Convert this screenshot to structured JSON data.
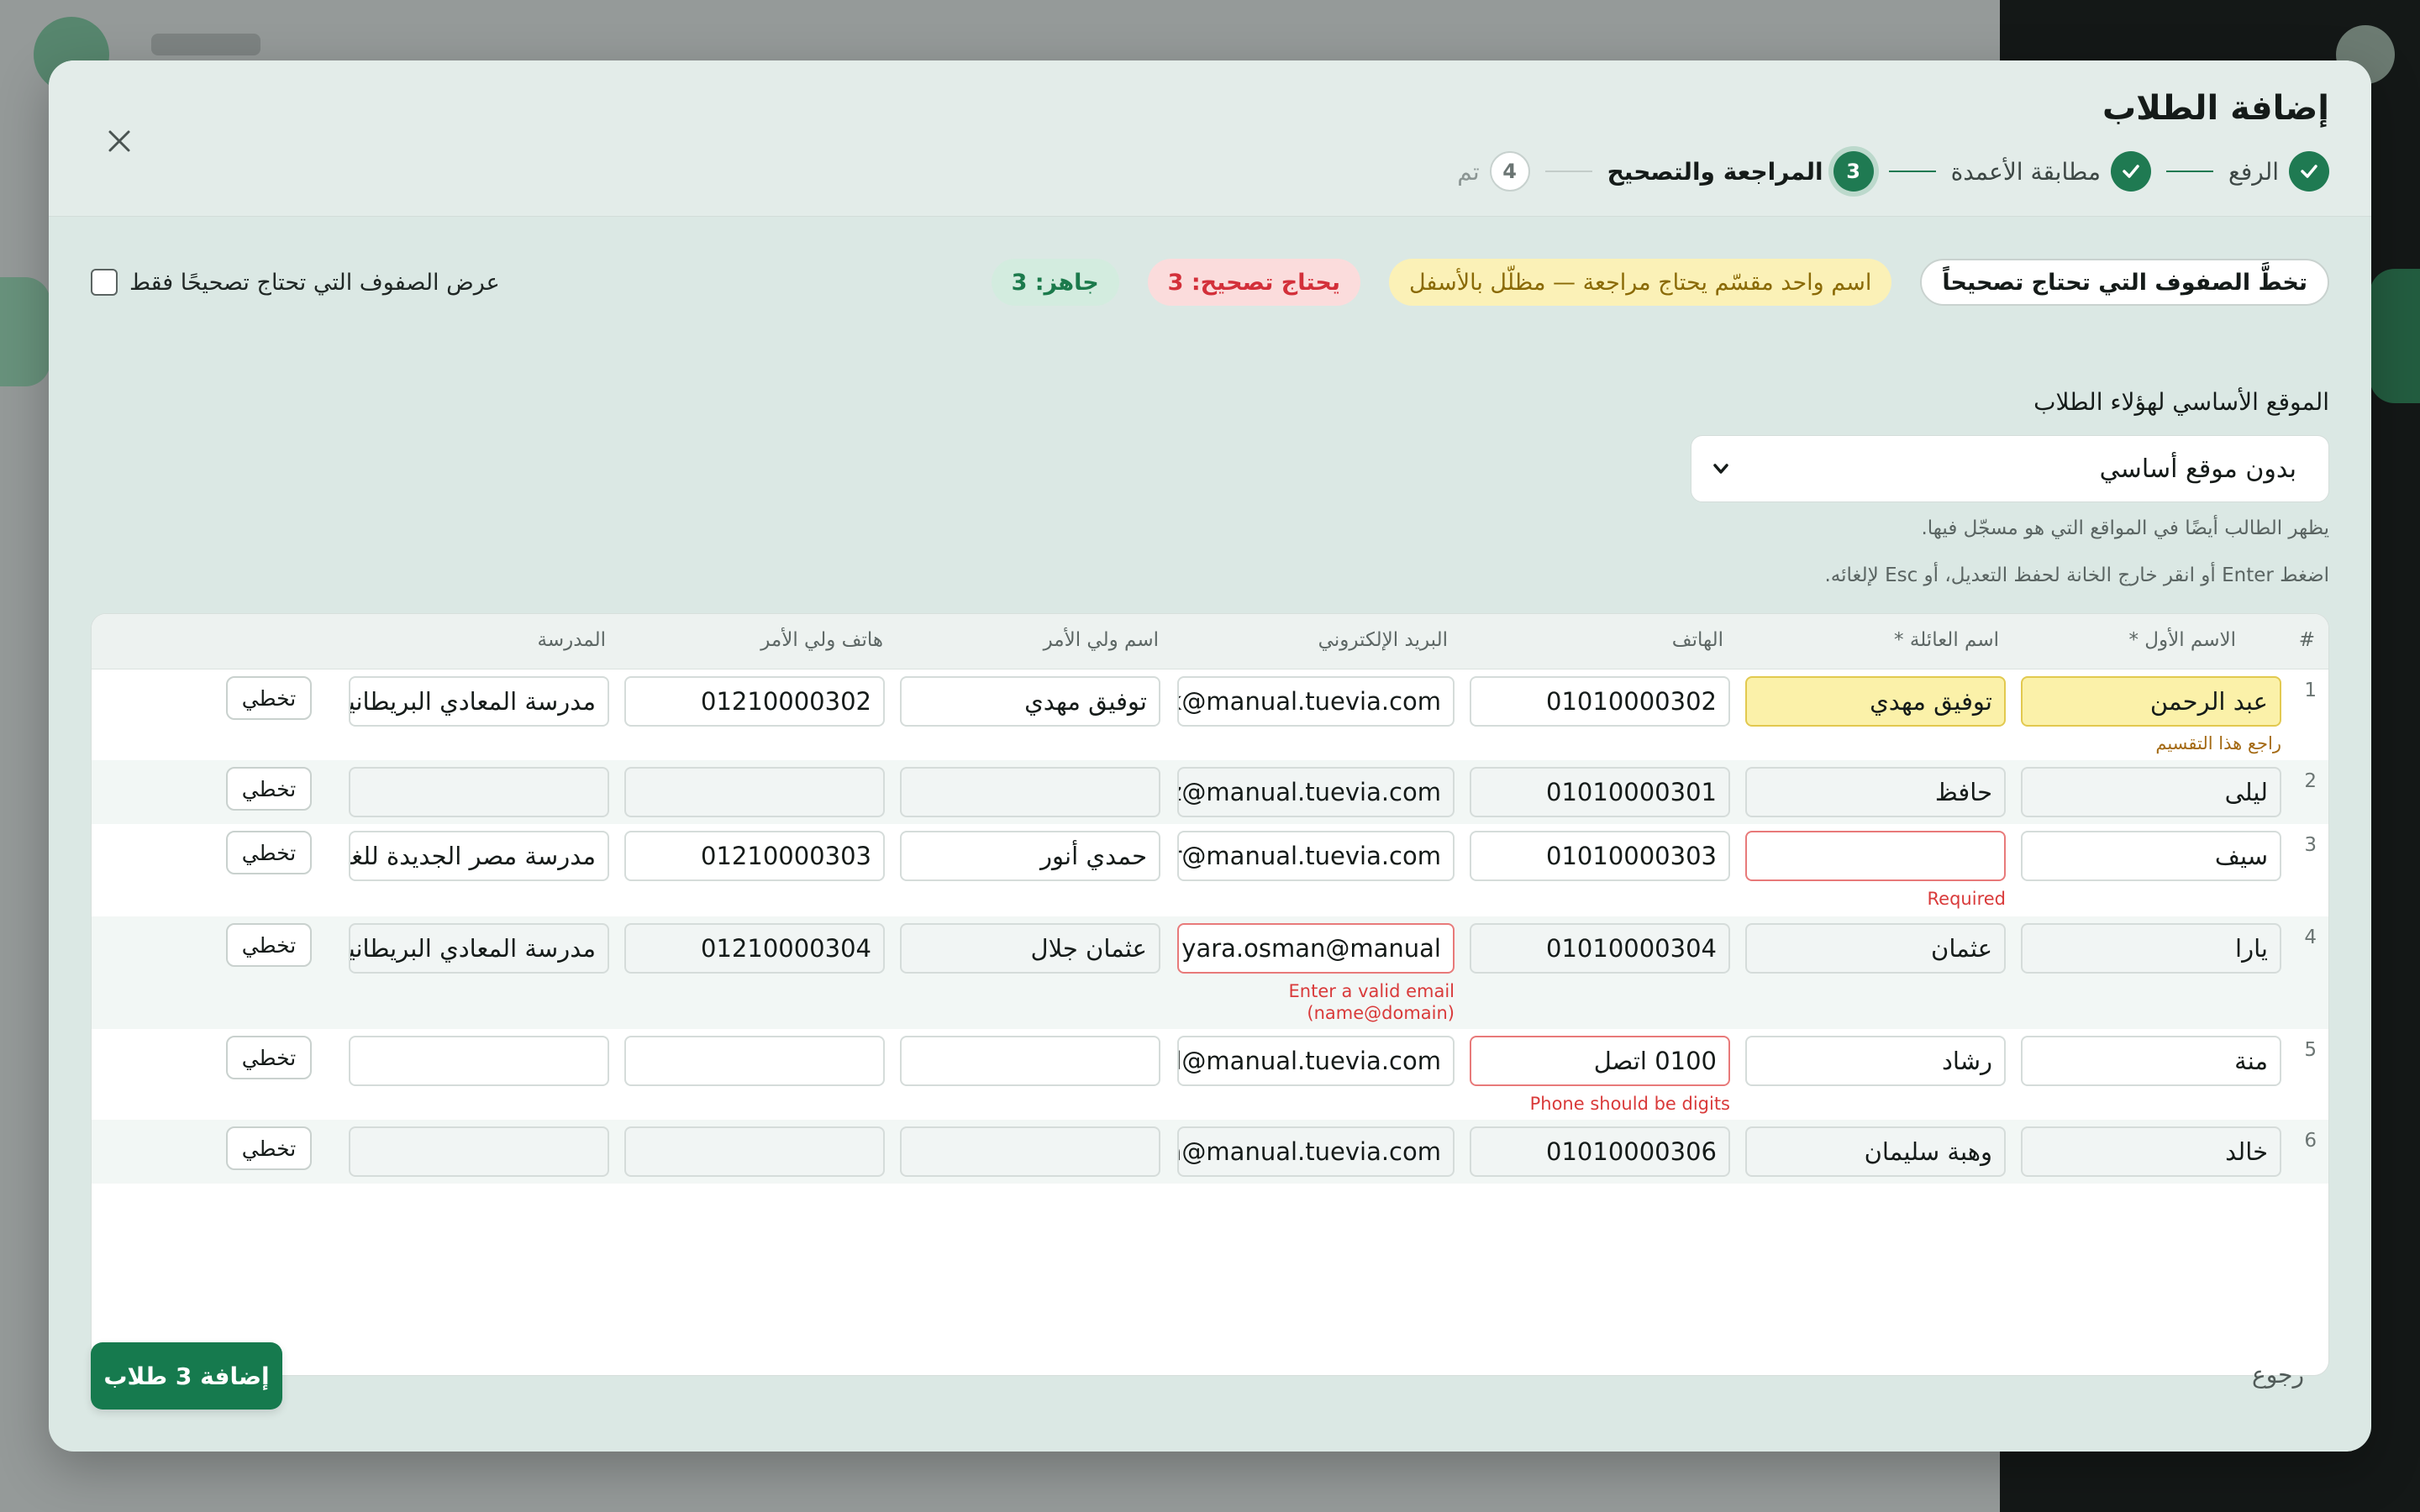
{
  "modal": {
    "title": "إضافة الطلاب",
    "close_icon": "close-icon"
  },
  "steps": [
    {
      "number": "✓",
      "label": "الرفع",
      "state": "done"
    },
    {
      "number": "✓",
      "label": "مطابقة الأعمدة",
      "state": "done"
    },
    {
      "number": "3",
      "label": "المراجعة والتصحيح",
      "state": "current"
    },
    {
      "number": "4",
      "label": "تم",
      "state": "todo"
    }
  ],
  "summary": {
    "ready": "جاهز: 3",
    "needs_fix": "يحتاج تصحيح: 3",
    "warning": "اسم واحد مقسّم يحتاج مراجعة — مظلّل بالأسفل",
    "skip_rows_button": "تخطَّ الصفوف التي تحتاج تصحيحاً",
    "show_only_label": "عرض الصفوف التي تحتاج تصحيحًا فقط",
    "show_only_checked": false
  },
  "primary_site": {
    "label": "الموقع الأساسي لهؤلاء الطلاب",
    "value": "بدون موقع أساسي",
    "hint": "يظهر الطالب أيضًا في المواقع التي هو مسجّل فيها.",
    "edit_hint": "اضغط Enter أو انقر خارج الخانة لحفظ التعديل، أو Esc لإلغائه."
  },
  "table": {
    "headers": {
      "num": "#",
      "first_name": "الاسم الأول *",
      "last_name": "اسم العائلة *",
      "phone": "الهاتف",
      "email": "البريد الإلكتروني",
      "guardian_name": "اسم ولي الأمر",
      "guardian_phone": "هاتف ولي الأمر",
      "school": "المدرسة"
    },
    "skip_label": "تخطي",
    "rows": [
      {
        "num": "1",
        "first": "عبد الرحمن",
        "last": "توفيق مهدي",
        "phone": "01010000302",
        "email": "tawfik@manual.tuevia.com",
        "gname": "توفيق مهدي",
        "gphone": "01210000302",
        "school": "مدرسة المعادي البريطانية",
        "note": "راجع هذا التقسيم"
      },
      {
        "num": "2",
        "first": "ليلى",
        "last": "حافظ",
        "phone": "01010000301",
        "email": "leila.hafez@manual.tuevia.com",
        "gname": "",
        "gphone": "",
        "school": "",
        "note": ""
      },
      {
        "num": "3",
        "first": "سيف",
        "last": "",
        "phone": "01010000303",
        "email": "saif.anwar@manual.tuevia.com",
        "gname": "حمدي أنور",
        "gphone": "01210000303",
        "school": "مدرسة مصر الجديدة للغات",
        "note": "Required"
      },
      {
        "num": "4",
        "first": "يارا",
        "last": "عثمان",
        "phone": "01010000304",
        "email": "yara.osman@manual",
        "gname": "عثمان جلال",
        "gphone": "01210000304",
        "school": "مدرسة المعادي البريطانية",
        "note": "Enter a valid email\n(name@domain)"
      },
      {
        "num": "5",
        "first": "منة",
        "last": "رشاد",
        "phone": "0100 اتصل",
        "email": "menna.rashad@manual.tuevia.com",
        "gname": "",
        "gphone": "",
        "school": "",
        "note": "Phone should be digits"
      },
      {
        "num": "6",
        "first": "خالد",
        "last": "وهبة سليمان",
        "phone": "01010000306",
        "email": "khaled.wahba@manual.tuevia.com",
        "gname": "",
        "gphone": "",
        "school": "",
        "note": ""
      }
    ]
  },
  "footer": {
    "back": "رجوع",
    "add_button": "إضافة 3 طلاب"
  },
  "colors": {
    "accent": "#167a4e",
    "error": "#d93a3a",
    "warning_bg": "#fbf1a9"
  }
}
